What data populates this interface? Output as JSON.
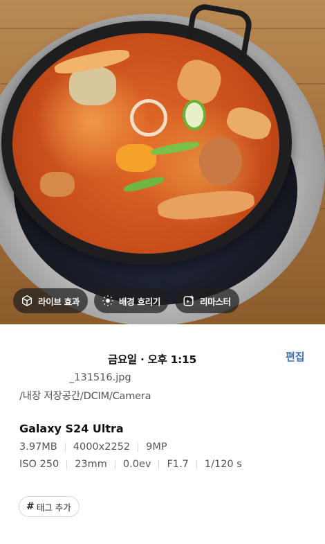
{
  "photo": {
    "alt": "",
    "chips": [
      {
        "label": "라이브 효과",
        "icon": "cube-live-icon"
      },
      {
        "label": "배경 흐리기",
        "icon": "background-blur-icon"
      },
      {
        "label": "리마스터",
        "icon": "remaster-sparkle-icon"
      }
    ]
  },
  "details": {
    "datetime": "금요일 · 오후 1:15",
    "edit_label": "편집",
    "filename": "_131516.jpg",
    "path": "/내장 저장공간/DCIM/Camera",
    "device": "Galaxy S24 Ultra",
    "file_info": [
      "3.97MB",
      "4000x2252",
      "9MP"
    ],
    "exposure": [
      "ISO 250",
      "23mm",
      "0.0ev",
      "F1.7",
      "1/120 s"
    ],
    "tag_button": {
      "hash": "#",
      "label": "태그 추가"
    }
  },
  "colors": {
    "edit": "#3d6fb6",
    "chip_bg": "rgba(30,30,30,0.72)",
    "text_secondary": "#555555"
  }
}
